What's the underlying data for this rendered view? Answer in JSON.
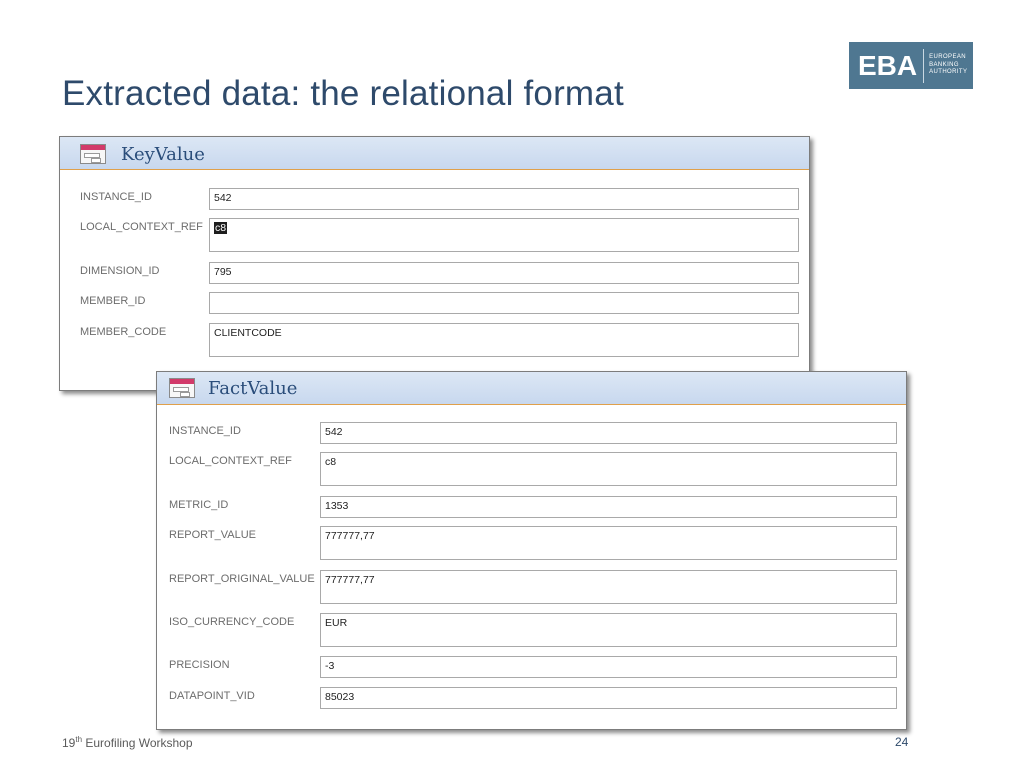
{
  "slide": {
    "title": "Extracted data: the relational format"
  },
  "logo": {
    "mark": "EBA",
    "words": [
      "EUROPEAN",
      "BANKING",
      "AUTHORITY"
    ],
    "color": "#4f7791"
  },
  "keyvalue_form": {
    "title": "KeyValue",
    "fields": [
      {
        "label": "INSTANCE_ID",
        "value": "542"
      },
      {
        "label": "LOCAL_CONTEXT_REF",
        "value": "c8"
      },
      {
        "label": "DIMENSION_ID",
        "value": "795"
      },
      {
        "label": "MEMBER_ID",
        "value": ""
      },
      {
        "label": "MEMBER_CODE",
        "value": "CLIENTCODE"
      }
    ]
  },
  "factvalue_form": {
    "title": "FactValue",
    "fields": [
      {
        "label": "INSTANCE_ID",
        "value": "542"
      },
      {
        "label": "LOCAL_CONTEXT_REF",
        "value": "c8"
      },
      {
        "label": "METRIC_ID",
        "value": "1353"
      },
      {
        "label": "REPORT_VALUE",
        "value": "777777,77"
      },
      {
        "label": "REPORT_ORIGINAL_VALUE",
        "value": "777777,77"
      },
      {
        "label": "ISO_CURRENCY_CODE",
        "value": "EUR"
      },
      {
        "label": "PRECISION",
        "value": "-3"
      },
      {
        "label": "DATAPOINT_VID",
        "value": "85023"
      }
    ]
  },
  "footer": {
    "workshop_number": "19",
    "workshop_suffix": "th",
    "workshop_name": " Eurofiling Workshop",
    "page_number": "24"
  },
  "icons": {
    "form": "access-form-icon"
  },
  "colors": {
    "title": "#2e4a6b",
    "form_header": "#c8d8ee",
    "form_header_border": "#e0a04a",
    "form_title": "#2a4d7a"
  }
}
